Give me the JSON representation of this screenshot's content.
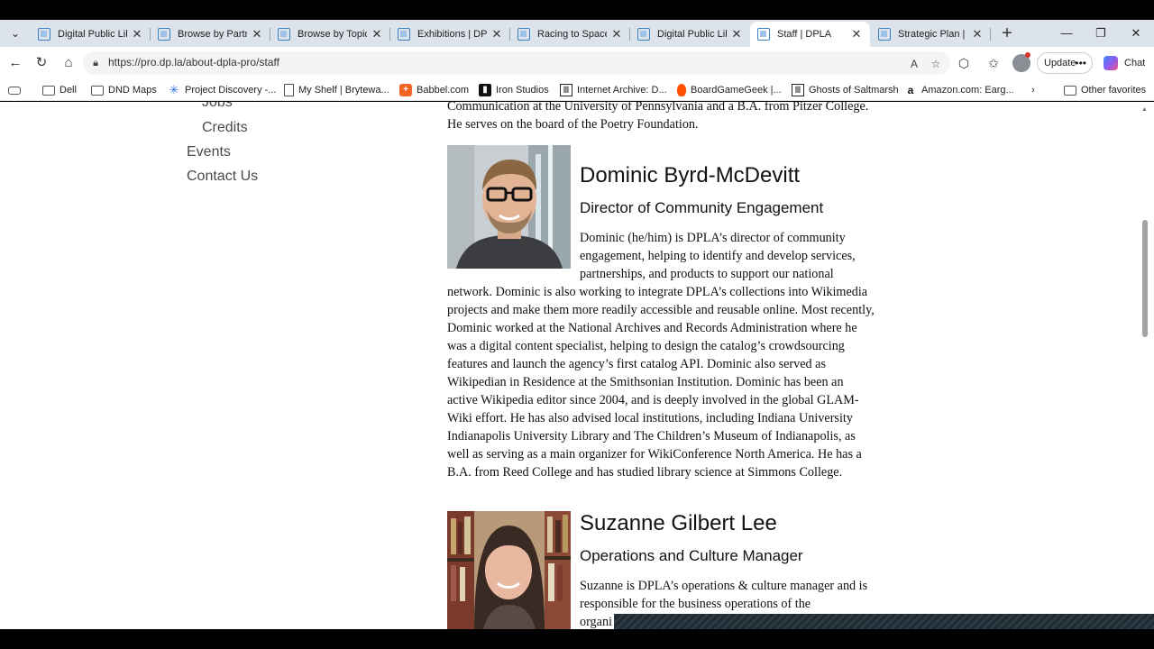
{
  "browser": {
    "tabs": [
      {
        "label": "Digital Public Librar",
        "active": false
      },
      {
        "label": "Browse by Partner |",
        "active": false
      },
      {
        "label": "Browse by Topic | D",
        "active": false
      },
      {
        "label": "Exhibitions | DPLA",
        "active": false
      },
      {
        "label": "Racing to Space | D",
        "active": false
      },
      {
        "label": "Digital Public Librar",
        "active": false
      },
      {
        "label": "Staff | DPLA",
        "active": true
      },
      {
        "label": "Strategic Plan | DPL",
        "active": false
      }
    ],
    "url": "https://pro.dp.la/about-dpla-pro/staff",
    "update_label": "Update",
    "chat_label": "Chat",
    "favorites": [
      {
        "label": "Dell",
        "icon": "folder-icon"
      },
      {
        "label": "DND Maps",
        "icon": "folder-icon"
      },
      {
        "label": "Project Discovery -...",
        "icon": "project-discovery-icon"
      },
      {
        "label": "My Shelf | Brytewa...",
        "icon": "document-icon"
      },
      {
        "label": "Babbel.com",
        "icon": "babbel-icon"
      },
      {
        "label": "Iron Studios",
        "icon": "iron-studios-icon"
      },
      {
        "label": "Internet Archive: D...",
        "icon": "internet-archive-icon"
      },
      {
        "label": "BoardGameGeek |...",
        "icon": "boardgamegeek-icon"
      },
      {
        "label": "Ghosts of Saltmarsh",
        "icon": "internet-archive-icon"
      },
      {
        "label": "Amazon.com: Earg...",
        "icon": "amazon-icon"
      }
    ],
    "other_favorites": "Other favorites"
  },
  "sidebar": {
    "items": [
      "Jobs",
      "Credits",
      "Events",
      "Contact Us"
    ]
  },
  "content": {
    "prev_bio_tail": [
      "Communication at the University of Pennsylvania and a B.A. from Pitzer College.",
      "He serves on the board of the Poetry Foundation."
    ],
    "staff": [
      {
        "name": "Dominic Byrd-McDevitt",
        "title": "Director of Community Engagement",
        "bio_lines": [
          "Dominic (he/him) is DPLA’s director of community",
          "engagement, helping to identify and develop services,",
          "partnerships, and products to support our national",
          "network. Dominic is also working to integrate DPLA’s collections into Wikimedia",
          "projects and make them more readily accessible and reusable online. Most recently,",
          "Dominic worked at the National Archives and Records Administration where he",
          "was a digital content specialist, helping to design the catalog’s crowdsourcing",
          "features and launch the agency’s first catalog API. Dominic also served as",
          "Wikipedian in Residence at the Smithsonian Institution. Dominic has been an",
          "active Wikipedia editor since 2004, and is deeply involved in the global GLAM-",
          "Wiki effort. He has also advised local institutions, including Indiana University",
          "Indianapolis University Library and The Children’s Museum of Indianapolis, as",
          "well as serving as a main organizer for WikiConference North America. He has a",
          "B.A. from Reed College and has studied library science at Simmons College."
        ]
      },
      {
        "name": "Suzanne Gilbert Lee",
        "title": "Operations and Culture Manager",
        "bio_lines": [
          "Suzanne is DPLA’s operations & culture manager and is",
          "responsible for the business operations of the",
          "organi"
        ]
      }
    ]
  },
  "colors": {
    "tabstrip": "#dde3ea",
    "accent": "#3b7fc4"
  }
}
